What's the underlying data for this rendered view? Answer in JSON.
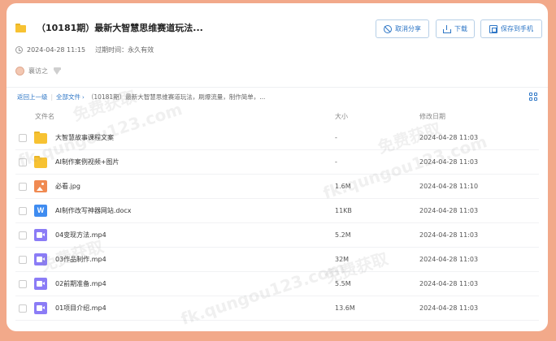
{
  "header": {
    "title": "（10181期）最新大智慧思维赛道玩法...",
    "created": "2024-04-28 11:15",
    "expiry_label": "过期时间：永久有效",
    "user": "襄访之"
  },
  "actions": {
    "cancel_share": "取消分享",
    "download": "下载",
    "save_to_phone": "保存到手机"
  },
  "breadcrumb": {
    "back": "返回上一级",
    "all_files": "全部文件",
    "current": "（10181期）最新大智慧思维赛道玩法，刷爆流量，制作简单，..."
  },
  "columns": {
    "name": "文件名",
    "size": "大小",
    "modified": "修改日期"
  },
  "files": [
    {
      "name": "大智慧故事课程文案",
      "size": "-",
      "date": "2024-04-28 11:03",
      "icon": "folder-icon"
    },
    {
      "name": "AI制作案例视频+图片",
      "size": "-",
      "date": "2024-04-28 11:03",
      "icon": "folder-icon"
    },
    {
      "name": "必看.jpg",
      "size": "1.6M",
      "date": "2024-04-28 11:10",
      "icon": "image-file-icon"
    },
    {
      "name": "AI制作改写神器网站.docx",
      "size": "11KB",
      "date": "2024-04-28 11:03",
      "icon": "word-file-icon",
      "icon_glyph": "W"
    },
    {
      "name": "04变现方法.mp4",
      "size": "5.2M",
      "date": "2024-04-28 11:03",
      "icon": "video-file-icon"
    },
    {
      "name": "03作品制作.mp4",
      "size": "32M",
      "date": "2024-04-28 11:03",
      "icon": "video-file-icon"
    },
    {
      "name": "02前期准备.mp4",
      "size": "5.5M",
      "date": "2024-04-28 11:03",
      "icon": "video-file-icon"
    },
    {
      "name": "01项目介绍.mp4",
      "size": "13.6M",
      "date": "2024-04-28 11:03",
      "icon": "video-file-icon"
    }
  ],
  "watermark": {
    "cn": "免费获取",
    "url": "fk.qungou123.com"
  },
  "colors": {
    "accent": "#2d76c6",
    "background": "#f2a98a",
    "folder": "#f7c232",
    "image": "#f08a52",
    "word": "#3f8cf0",
    "video": "#8b7cf6"
  }
}
